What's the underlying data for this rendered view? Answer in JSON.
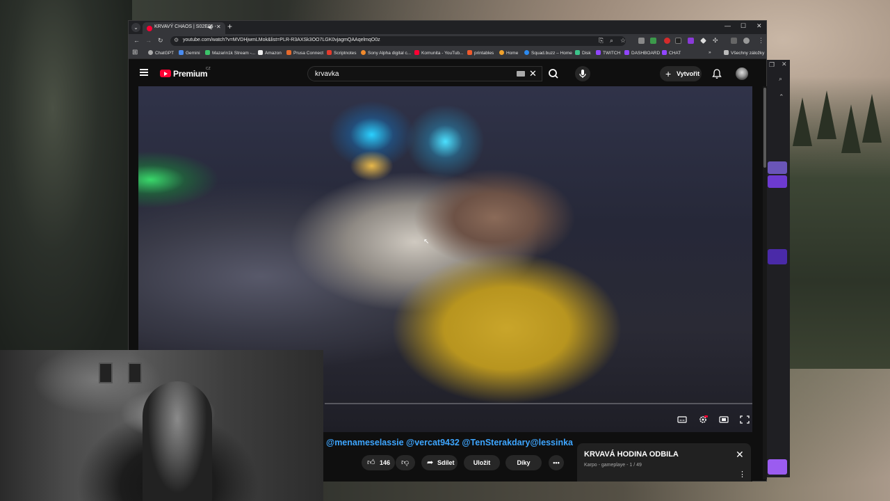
{
  "browser": {
    "tab_title": "KRVAVÝ CHAOS | S02E05 -",
    "url": "youtube.com/watch?v=MVDHjwmLMok&list=PLR-R3AXSk3OO7LGK0vjagmQAAqelmqO0z",
    "bookmarks": [
      "ChatGPT",
      "Gemini",
      "Mazarin1k Stream -...",
      "Amazon",
      "Prusa Connect",
      "Scriptnotes",
      "Sony Alpha digital c...",
      "Komunita - YouTub...",
      "printables",
      "Home",
      "Squad.buzz – Home",
      "Disk",
      "TWITCH",
      "DASHBOARD",
      "CHAT"
    ],
    "all_bookmarks": "Všechny záložky"
  },
  "youtube": {
    "logo": "Premium",
    "logo_country": "CZ",
    "search_query": "krvavka",
    "create_label": "Vytvořit",
    "video_title": "@menameselassie @vercat9432 @TenSterakdary@lessinka",
    "like_count": "146",
    "share_label": "Sdílet",
    "save_label": "Uložit",
    "thanks_label": "Díky",
    "settings_badge": "HD",
    "playlist": {
      "title": "KRVAVÁ HODINA ODBILA",
      "subtitle": "Karpo - gameplaye - 1 / 49"
    }
  },
  "colors": {
    "accent": "#ff0033",
    "link": "#3ea6ff",
    "background": "#0f0f0f",
    "pill": "#272727"
  },
  "icons": [
    "hamburger-icon",
    "search-icon",
    "mic-icon",
    "bell-icon",
    "like-icon",
    "dislike-icon",
    "share-icon",
    "more-icon",
    "captions-icon",
    "settings-icon",
    "miniplayer-icon",
    "fullscreen-icon",
    "close-icon"
  ]
}
